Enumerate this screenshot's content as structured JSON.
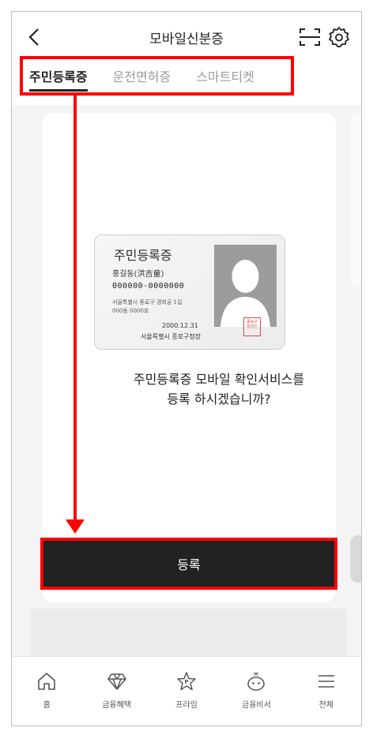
{
  "header": {
    "title": "모바일신분증"
  },
  "tabs": [
    {
      "label": "주민등록증",
      "active": true
    },
    {
      "label": "운전면허증",
      "active": false
    },
    {
      "label": "스마트티켓",
      "active": false
    }
  ],
  "id_card": {
    "title": "주민등록증",
    "name": "홍길동(洪吉童)",
    "number": "000000-0000000",
    "address_line1": "서울특별시 종로구 경희궁 1길",
    "address_line2": "000동 0000호",
    "issue_date": "2000.12.31",
    "issuer": "서울특별시 종로구청장",
    "seal_text": "종로구청장인"
  },
  "message": {
    "line1": "주민등록증 모바일 확인서비스를",
    "line2": "등록 하시겠습니까?"
  },
  "register_button": {
    "label": "등록"
  },
  "bottom_nav": [
    {
      "label": "홈",
      "icon": "home-icon"
    },
    {
      "label": "금융혜택",
      "icon": "diamond-icon"
    },
    {
      "label": "프라임",
      "icon": "star-p-icon"
    },
    {
      "label": "금융비서",
      "icon": "robot-icon"
    },
    {
      "label": "전체",
      "icon": "menu-icon"
    }
  ],
  "colors": {
    "highlight": "#ff0000",
    "primary_button": "#222222",
    "background": "#f4f4f5"
  }
}
